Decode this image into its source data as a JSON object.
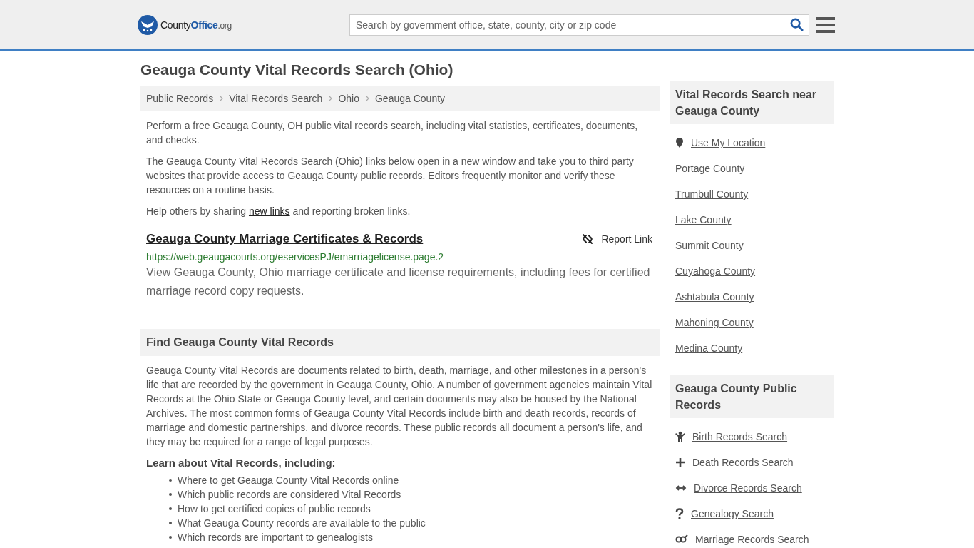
{
  "header": {
    "logo": {
      "parts": [
        "County",
        "Office",
        ".org"
      ]
    },
    "search": {
      "placeholder": "Search by government office, state, county, city or zip code"
    }
  },
  "title": "Geauga County Vital Records Search (Ohio)",
  "breadcrumbs": [
    "Public Records",
    "Vital Records Search",
    "Ohio",
    "Geauga County"
  ],
  "intro": [
    "Perform a free Geauga County, OH public vital records search, including vital statistics, certificates, documents, and checks.",
    "The Geauga County Vital Records Search (Ohio) links below open in a new window and take you to third party websites that provide access to Geauga County public records. Editors frequently monitor and verify these resources on a routine basis."
  ],
  "share": {
    "before": "Help others by sharing",
    "link": "new links",
    "after": "and reporting broken links."
  },
  "links": [
    {
      "title": "Geauga County Marriage Certificates & Records",
      "report": "Report Link",
      "url": "https://web.geaugacourts.org/eservicesPJ/emarriagelicense.page.2",
      "description": "View Geauga County, Ohio marriage certificate and license requirements, including fees for certified marriage record copy requests."
    }
  ],
  "find": {
    "heading": "Find Geauga County Vital Records",
    "text": "Geauga County Vital Records are documents related to birth, death, marriage, and other milestones in a person's life that are recorded by the government in Geauga County, Ohio. A number of government agencies maintain Vital Records at the Ohio State or Geauga County level, and certain documents may also be housed by the National Archives. The most common forms of Geauga County Vital Records include birth and death records, records of marriage and domestic partnerships, and divorce records. These public records all document a person's life, and they may be required for a range of legal purposes.",
    "learn_heading": "Learn about Vital Records, including:",
    "learn_items": [
      "Where to get Geauga County Vital Records online",
      "Which public records are considered Vital Records",
      "How to get certified copies of public records",
      "What Geauga County records are available to the public",
      "Which records are important to genealogists"
    ]
  },
  "sidebar": [
    {
      "heading": "Vital Records Search near Geauga County",
      "items": [
        {
          "kind": "location",
          "label": "Use My Location"
        },
        {
          "kind": "plain",
          "label": "Portage County"
        },
        {
          "kind": "plain",
          "label": "Trumbull County"
        },
        {
          "kind": "plain",
          "label": "Lake County"
        },
        {
          "kind": "plain",
          "label": "Summit County"
        },
        {
          "kind": "plain",
          "label": "Cuyahoga County"
        },
        {
          "kind": "plain",
          "label": "Ashtabula County"
        },
        {
          "kind": "plain",
          "label": "Mahoning County"
        },
        {
          "kind": "plain",
          "label": "Medina County"
        }
      ]
    },
    {
      "heading": "Geauga County Public Records",
      "items": [
        {
          "kind": "birth",
          "label": "Birth Records Search"
        },
        {
          "kind": "death",
          "label": "Death Records Search"
        },
        {
          "kind": "divorce",
          "label": "Divorce Records Search"
        },
        {
          "kind": "genealogy",
          "label": "Genealogy Search"
        },
        {
          "kind": "marriage",
          "label": "Marriage Records Search"
        }
      ]
    }
  ]
}
